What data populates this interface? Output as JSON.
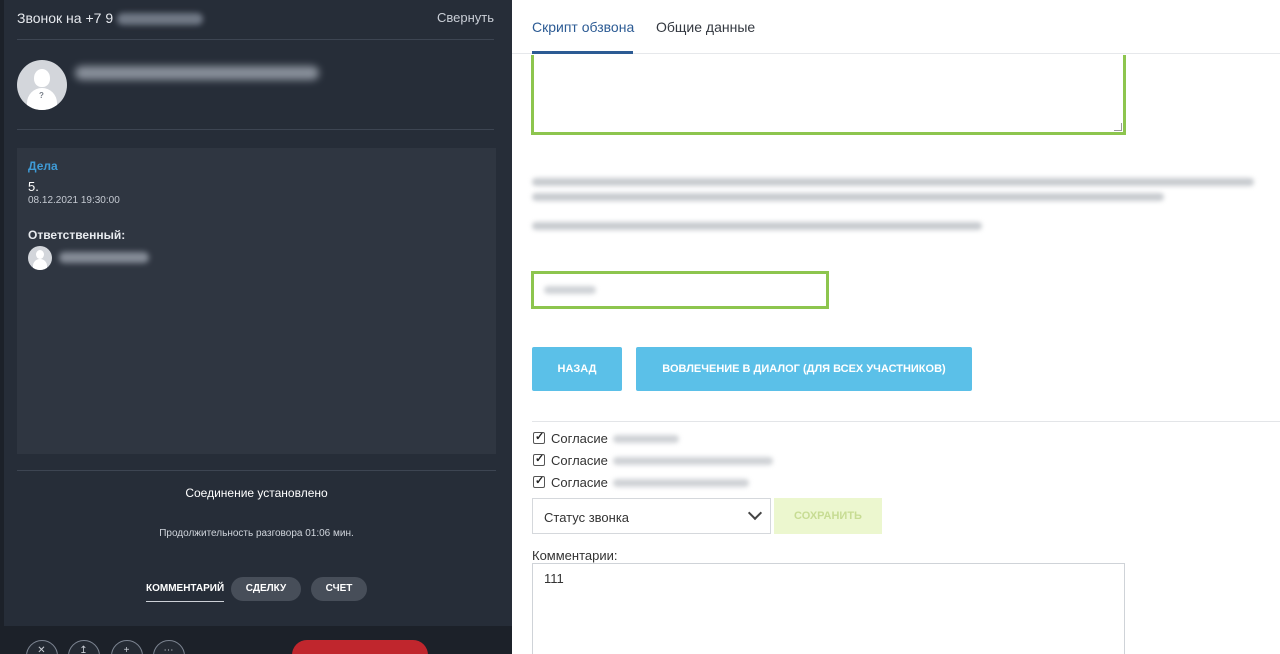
{
  "call": {
    "title": "Звонок на +7 9",
    "collapse_label": "Свернуть"
  },
  "deals": {
    "title": "Дела",
    "number": "5.",
    "datetime": "08.12.2021 19:30:00",
    "responsible_label": "Ответственный:"
  },
  "connection": {
    "status": "Соединение установлено",
    "duration": "Продолжительность разговора 01:06 мин."
  },
  "action_tabs": {
    "comment": "КОММЕНТАРИЙ",
    "deal": "СДЕЛКУ",
    "invoice": "СЧЕТ"
  },
  "tabs": {
    "script": "Скрипт обзвона",
    "general": "Общие данные"
  },
  "buttons": {
    "back": "НАЗАД",
    "involve": "ВОВЛЕЧЕНИЕ В ДИАЛОГ (ДЛЯ ВСЕХ УЧАСТНИКОВ)",
    "save": "СОХРАНИТЬ"
  },
  "consents": [
    {
      "label": "Согласие",
      "checked": true
    },
    {
      "label": "Согласие",
      "checked": true
    },
    {
      "label": "Согласие",
      "checked": true
    }
  ],
  "status_select": {
    "value": "Статус звонка"
  },
  "comments": {
    "label": "Комментарии:",
    "value": "111"
  },
  "colors": {
    "accent_blue": "#5bc0e8",
    "tab_active": "#2c5b94",
    "input_green": "#8dc54e",
    "panel_dark": "#262d38",
    "hangup_red": "#c0262d"
  }
}
